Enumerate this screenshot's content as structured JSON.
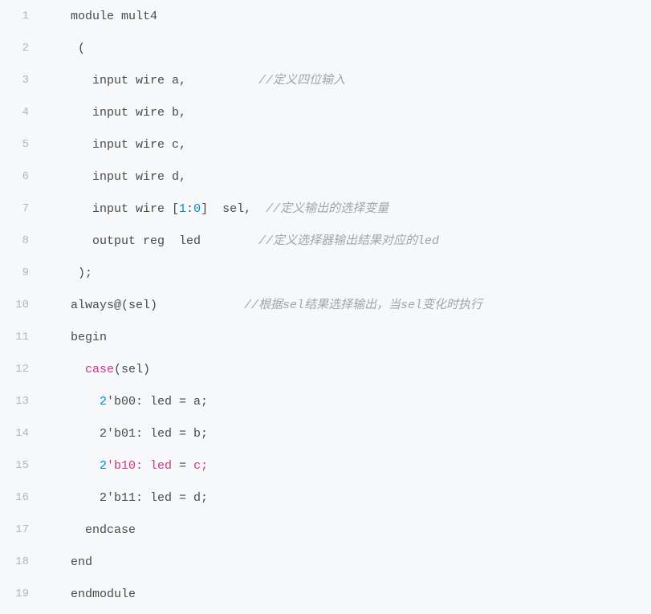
{
  "lines": [
    {
      "num": "1",
      "segments": [
        {
          "t": "    module mult4",
          "c": ""
        }
      ]
    },
    {
      "num": "2",
      "segments": [
        {
          "t": "     (",
          "c": ""
        }
      ]
    },
    {
      "num": "3",
      "segments": [
        {
          "t": "       input wire a,          ",
          "c": ""
        },
        {
          "t": "//定义四位输入",
          "c": "tok-comment"
        }
      ]
    },
    {
      "num": "4",
      "segments": [
        {
          "t": "       input wire b,",
          "c": ""
        }
      ]
    },
    {
      "num": "5",
      "segments": [
        {
          "t": "       input wire c,",
          "c": ""
        }
      ]
    },
    {
      "num": "6",
      "segments": [
        {
          "t": "       input wire d,",
          "c": ""
        }
      ]
    },
    {
      "num": "7",
      "segments": [
        {
          "t": "       input wire [",
          "c": ""
        },
        {
          "t": "1",
          "c": "tok-num"
        },
        {
          "t": ":",
          "c": ""
        },
        {
          "t": "0",
          "c": "tok-num"
        },
        {
          "t": "]  sel,  ",
          "c": ""
        },
        {
          "t": "//定义输出的选择变量",
          "c": "tok-comment"
        }
      ]
    },
    {
      "num": "8",
      "segments": [
        {
          "t": "       output reg  led        ",
          "c": ""
        },
        {
          "t": "//定义选择器输出结果对应的led",
          "c": "tok-comment"
        }
      ]
    },
    {
      "num": "9",
      "segments": [
        {
          "t": "     );",
          "c": ""
        }
      ]
    },
    {
      "num": "10",
      "segments": [
        {
          "t": "    always@(sel)            ",
          "c": ""
        },
        {
          "t": "//根据sel结果选择输出，当sel变化时执行",
          "c": "tok-comment"
        }
      ]
    },
    {
      "num": "11",
      "segments": [
        {
          "t": "    begin",
          "c": ""
        }
      ]
    },
    {
      "num": "12",
      "segments": [
        {
          "t": "      ",
          "c": ""
        },
        {
          "t": "case",
          "c": "tok-red"
        },
        {
          "t": "(sel)",
          "c": ""
        }
      ]
    },
    {
      "num": "13",
      "segments": [
        {
          "t": "        ",
          "c": ""
        },
        {
          "t": "2",
          "c": "tok-num"
        },
        {
          "t": "'b00: led = a;",
          "c": ""
        }
      ]
    },
    {
      "num": "14",
      "segments": [
        {
          "t": "        2'b01: led = b;",
          "c": ""
        }
      ]
    },
    {
      "num": "15",
      "segments": [
        {
          "t": "        ",
          "c": ""
        },
        {
          "t": "2",
          "c": "tok-num"
        },
        {
          "t": "'b10: led ",
          "c": "tok-red"
        },
        {
          "t": "=",
          "c": ""
        },
        {
          "t": " c;",
          "c": "tok-red"
        }
      ]
    },
    {
      "num": "16",
      "segments": [
        {
          "t": "        2'b11: led = d;",
          "c": ""
        }
      ]
    },
    {
      "num": "17",
      "segments": [
        {
          "t": "      endcase",
          "c": ""
        }
      ]
    },
    {
      "num": "18",
      "segments": [
        {
          "t": "    end",
          "c": ""
        }
      ]
    },
    {
      "num": "19",
      "segments": [
        {
          "t": "    endmodule",
          "c": ""
        }
      ]
    }
  ]
}
